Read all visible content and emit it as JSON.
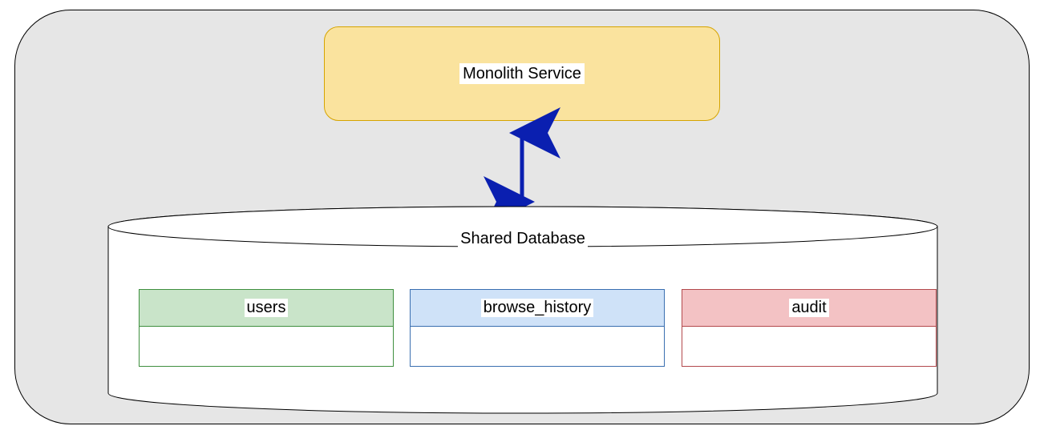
{
  "service": {
    "label": "Monolith Service"
  },
  "database": {
    "label": "Shared Database",
    "tables": [
      {
        "name": "users"
      },
      {
        "name": "browse_history"
      },
      {
        "name": "audit"
      }
    ]
  },
  "arrow": {
    "direction": "bidirectional",
    "color": "#0a1fb0"
  },
  "colors": {
    "outer_bg": "#e6e6e6",
    "service_bg": "#fae39e",
    "service_border": "#d6a400",
    "table_green_bg": "#c9e4c9",
    "table_green_border": "#3f8f3f",
    "table_blue_bg": "#cfe2f8",
    "table_blue_border": "#3a6fb0",
    "table_red_bg": "#f3c2c4",
    "table_red_border": "#b3494d"
  }
}
